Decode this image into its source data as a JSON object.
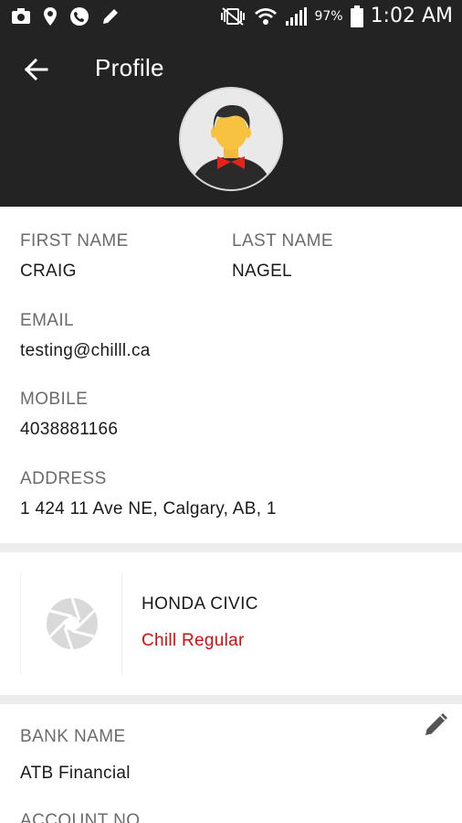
{
  "status_bar": {
    "battery_percent": "97%",
    "time": "1:02 AM"
  },
  "header": {
    "title": "Profile"
  },
  "profile": {
    "first_name_label": "FIRST NAME",
    "first_name": "CRAIG",
    "last_name_label": "LAST NAME",
    "last_name": "NAGEL",
    "email_label": "EMAIL",
    "email": "testing@chilll.ca",
    "mobile_label": "MOBILE",
    "mobile": "4038881166",
    "address_label": "ADDRESS",
    "address": "1 424 11 Ave NE, Calgary, AB, 1"
  },
  "vehicle": {
    "name": "HONDA CIVIC",
    "plan": "Chill Regular",
    "plan_color": "#d60d0d"
  },
  "bank": {
    "bank_name_label": "BANK NAME",
    "bank_name": "ATB Financial",
    "account_no_label": "ACCOUNT NO"
  },
  "colors": {
    "header_bg": "#232323",
    "divider": "#ececec",
    "label": "#6b6b6b"
  },
  "icons": {
    "back": "arrow-left-icon",
    "edit": "pencil-icon",
    "vehicle_placeholder": "camera-aperture-icon"
  }
}
